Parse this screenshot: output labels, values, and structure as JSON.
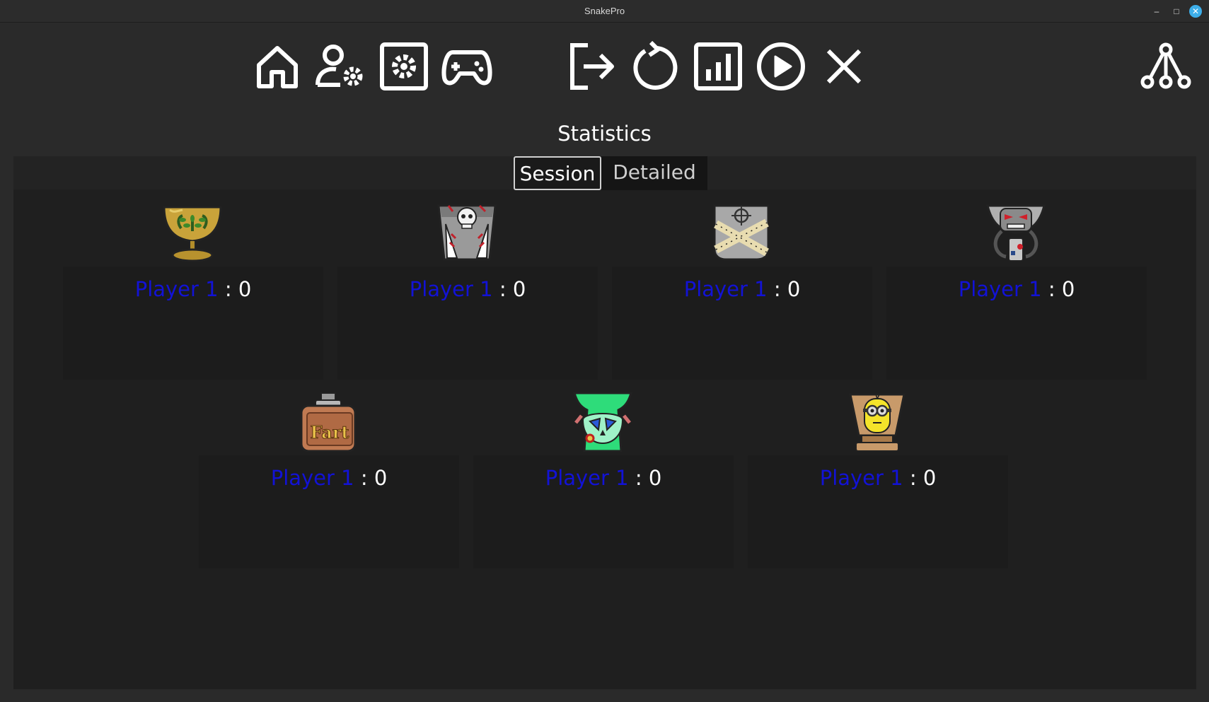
{
  "window": {
    "title": "SnakePro",
    "minimize": "–",
    "maximize": "□",
    "close": "✕"
  },
  "toolbar": {
    "left_icons": [
      "home-icon",
      "user-settings-icon",
      "settings-icon",
      "gamepad-icon"
    ],
    "center_icons": [
      "exit-icon",
      "restart-icon",
      "statistics-icon",
      "play-icon",
      "close-icon"
    ],
    "right_icons": [
      "network-icon"
    ]
  },
  "heading": "Statistics",
  "tabs": {
    "session": "Session",
    "detailed": "Detailed",
    "selected": "session"
  },
  "stats": [
    {
      "icon": "trophy-icon",
      "player": "Player 1",
      "separator": " : ",
      "score": "0"
    },
    {
      "icon": "skull-trophy-icon",
      "player": "Player 1",
      "separator": " : ",
      "score": "0"
    },
    {
      "icon": "crosshair-bullets-trophy-icon",
      "player": "Player 1",
      "separator": " : ",
      "score": "0"
    },
    {
      "icon": "robot-skull-trophy-icon",
      "player": "Player 1",
      "separator": " : ",
      "score": "0"
    },
    {
      "icon": "fart-jar-trophy-icon",
      "player": "Player 1",
      "separator": " : ",
      "score": "0"
    },
    {
      "icon": "green-skull-trophy-icon",
      "player": "Player 1",
      "separator": " : ",
      "score": "0"
    },
    {
      "icon": "yellow-minion-trophy-icon",
      "player": "Player 1",
      "separator": " : ",
      "score": "0"
    }
  ],
  "colors": {
    "player": "#1212d6",
    "score": "#ffffff",
    "background": "#2a2a2a",
    "panel": "#1f1f1f"
  }
}
